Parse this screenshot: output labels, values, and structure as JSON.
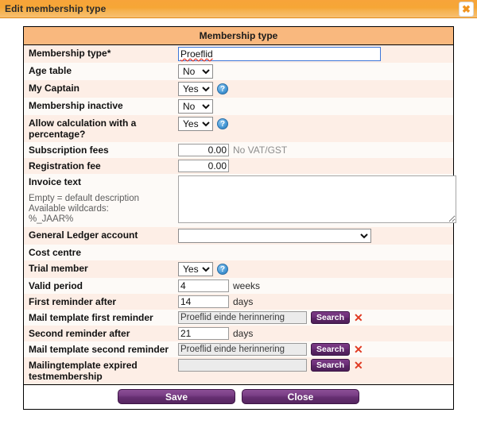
{
  "window": {
    "title": "Edit membership type",
    "close_icon": "close-icon",
    "close_glyph": "✖",
    "accent_orange": "#f6a636",
    "accent_purple": "#662f72"
  },
  "form": {
    "section_title": "Membership type",
    "rows": [
      {
        "label": "Membership type*",
        "type": "text-focused",
        "value": "Proeflid"
      },
      {
        "label": "Age table",
        "type": "select",
        "value": "No",
        "options": [
          "Yes",
          "No"
        ],
        "help": false
      },
      {
        "label": "My Captain",
        "type": "select",
        "value": "Yes",
        "options": [
          "Yes",
          "No"
        ],
        "help": true
      },
      {
        "label": "Membership inactive",
        "type": "select",
        "value": "No",
        "options": [
          "Yes",
          "No"
        ],
        "help": false
      },
      {
        "label": "Allow calculation with a percentage?",
        "type": "select",
        "value": "Yes",
        "options": [
          "Yes",
          "No"
        ],
        "help": true
      },
      {
        "label": "Subscription fees",
        "type": "number",
        "value": "0.00",
        "suffix": "No VAT/GST"
      },
      {
        "label": "Registration fee",
        "type": "number",
        "value": "0.00",
        "suffix": ""
      },
      {
        "label": "Invoice text",
        "type": "textarea",
        "value": "",
        "hint": [
          "Empty = default description",
          "Available wildcards:",
          "%_JAAR%"
        ]
      },
      {
        "label": "General Ledger account",
        "type": "select-wide",
        "value": "",
        "options": [
          ""
        ]
      },
      {
        "label": "Cost centre",
        "type": "none",
        "value": ""
      },
      {
        "label": "Trial member",
        "type": "select",
        "value": "Yes",
        "options": [
          "Yes",
          "No"
        ],
        "help": true
      },
      {
        "label": "Valid period",
        "type": "number-left",
        "value": "4",
        "suffix": "weeks"
      },
      {
        "label": "First reminder after",
        "type": "number-left",
        "value": "14",
        "suffix": "days"
      },
      {
        "label": "Mail template first reminder",
        "type": "search",
        "value": "Proeflid einde herinnering",
        "button": "Search",
        "delete_glyph": "✕"
      },
      {
        "label": "Second reminder after",
        "type": "number-left",
        "value": "21",
        "suffix": "days"
      },
      {
        "label": "Mail template second reminder",
        "type": "search",
        "value": "Proeflid einde herinnering",
        "button": "Search",
        "delete_glyph": "✕"
      },
      {
        "label": "Mailingtemplate expired testmembership",
        "type": "search",
        "value": "",
        "button": "Search",
        "delete_glyph": "✕"
      }
    ]
  },
  "footer": {
    "save_label": "Save",
    "close_label": "Close"
  }
}
